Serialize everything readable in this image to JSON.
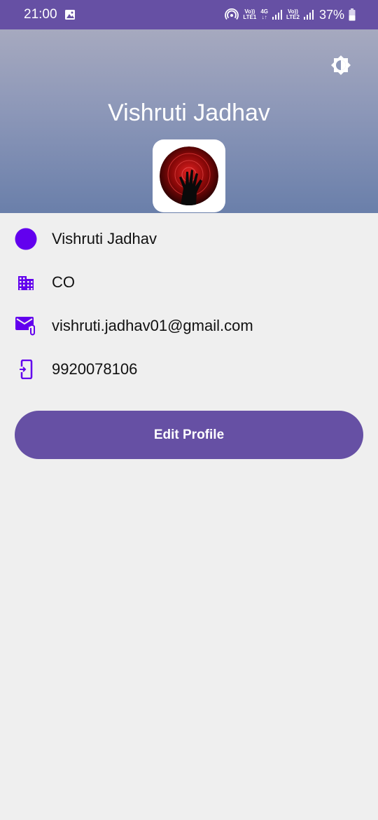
{
  "status_bar": {
    "time": "21:00",
    "sim1_top": "Vo)) ",
    "sim1_bottom": "LTE1",
    "net_top": "4G",
    "net_bottom": "↓↑",
    "sim2_top": "Vo))",
    "sim2_bottom": "LTE2",
    "battery": "37%"
  },
  "header": {
    "name": "Vishruti Jadhav",
    "brightness_icon": "brightness-icon"
  },
  "profile": {
    "name": "Vishruti Jadhav",
    "department": "CO",
    "email": "vishruti.jadhav01@gmail.com",
    "phone": "9920078106"
  },
  "actions": {
    "edit_label": "Edit Profile"
  },
  "colors": {
    "primary": "#6650a4",
    "icon": "#6200ee",
    "background": "#efefef"
  }
}
